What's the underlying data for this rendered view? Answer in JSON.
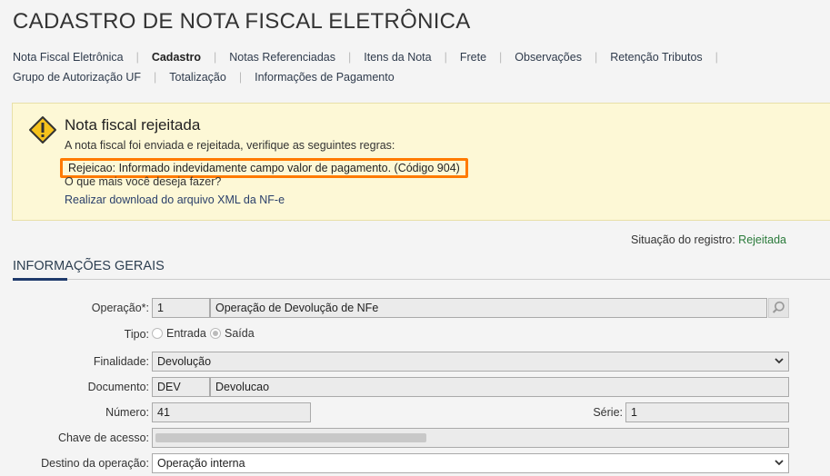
{
  "page_title": "CADASTRO DE NOTA FISCAL ELETRÔNICA",
  "nav": {
    "row1": [
      "Nota Fiscal Eletrônica",
      "Cadastro",
      "Notas Referenciadas",
      "Itens da Nota",
      "Frete",
      "Observações",
      "Retenção Tributos"
    ],
    "row2": [
      "Grupo de Autorização UF",
      "Totalização",
      "Informações de Pagamento"
    ],
    "active": "Cadastro"
  },
  "alert": {
    "icon": "warning-icon",
    "title": "Nota fiscal rejeitada",
    "message": "A nota fiscal foi enviada e rejeitada, verifique as seguintes regras:",
    "rule": "Rejeicao: Informado indevidamente campo valor de pagamento. (Código 904)",
    "question": "O que mais você deseja fazer?",
    "download_link": "Realizar download do arquivo XML da NF-e",
    "highlight_color": "#ff7a00"
  },
  "status": {
    "label": "Situação do registro:",
    "value": "Rejeitada"
  },
  "section_title": "INFORMAÇÕES GERAIS",
  "form": {
    "operacao": {
      "label": "Operação*:",
      "code": "1",
      "description": "Operação de Devolução de NFe"
    },
    "tipo": {
      "label": "Tipo:",
      "options": [
        "Entrada",
        "Saída"
      ],
      "selected": "Saída"
    },
    "finalidade": {
      "label": "Finalidade:",
      "value": "Devolução"
    },
    "documento": {
      "label": "Documento:",
      "code": "DEV",
      "description": "Devolucao"
    },
    "numero": {
      "label": "Número:",
      "value": "41"
    },
    "serie": {
      "label": "Série:",
      "value": "1"
    },
    "chave": {
      "label": "Chave de acesso:"
    },
    "destino": {
      "label": "Destino da operação:",
      "value": "Operação interna"
    }
  }
}
